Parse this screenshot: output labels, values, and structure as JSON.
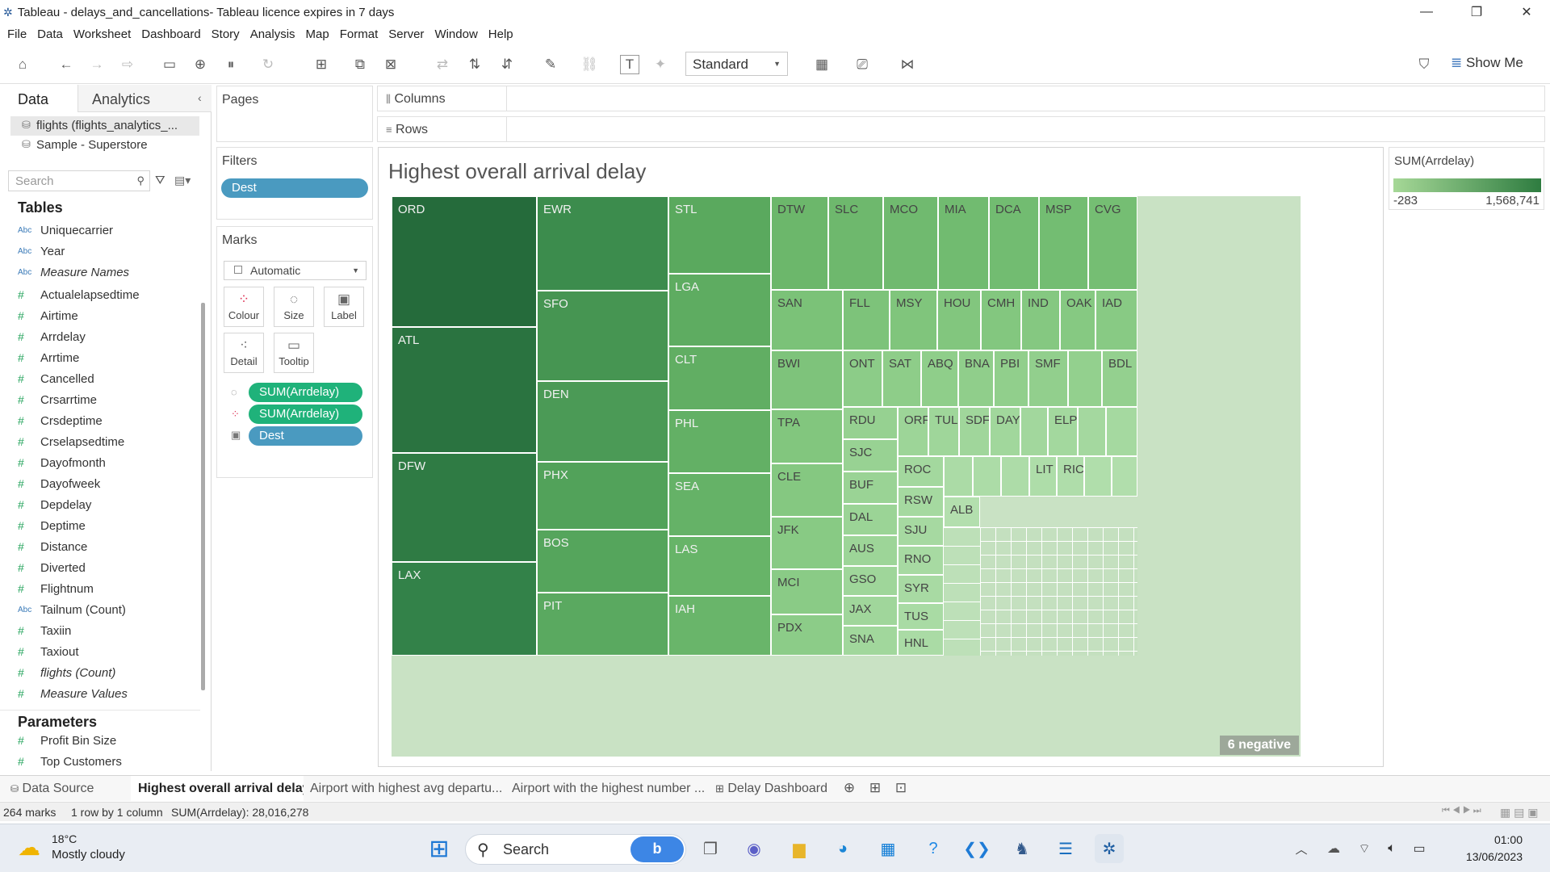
{
  "window": {
    "title": "Tableau - delays_and_cancellations- Tableau licence expires in 7 days"
  },
  "menu": [
    "File",
    "Data",
    "Worksheet",
    "Dashboard",
    "Story",
    "Analysis",
    "Map",
    "Format",
    "Server",
    "Window",
    "Help"
  ],
  "toolbar": {
    "fit_mode": "Standard",
    "show_me": "Show Me"
  },
  "left": {
    "tab_data": "Data",
    "tab_analytics": "Analytics",
    "datasources": [
      "flights (flights_analytics_...",
      "Sample - Superstore"
    ],
    "search_placeholder": "Search",
    "tables_heading": "Tables",
    "fields": [
      {
        "name": "Uniquecarrier",
        "type": "Abc"
      },
      {
        "name": "Year",
        "type": "Abc"
      },
      {
        "name": "Measure Names",
        "type": "Abc"
      },
      {
        "name": "Actualelapsedtime",
        "type": "#"
      },
      {
        "name": "Airtime",
        "type": "#"
      },
      {
        "name": "Arrdelay",
        "type": "#"
      },
      {
        "name": "Arrtime",
        "type": "#"
      },
      {
        "name": "Cancelled",
        "type": "#"
      },
      {
        "name": "Crsarrtime",
        "type": "#"
      },
      {
        "name": "Crsdeptime",
        "type": "#"
      },
      {
        "name": "Crselapsedtime",
        "type": "#"
      },
      {
        "name": "Dayofmonth",
        "type": "#"
      },
      {
        "name": "Dayofweek",
        "type": "#"
      },
      {
        "name": "Depdelay",
        "type": "#"
      },
      {
        "name": "Deptime",
        "type": "#"
      },
      {
        "name": "Distance",
        "type": "#"
      },
      {
        "name": "Diverted",
        "type": "#"
      },
      {
        "name": "Flightnum",
        "type": "#"
      },
      {
        "name": "Tailnum (Count)",
        "type": "Abc"
      },
      {
        "name": "Taxiin",
        "type": "#"
      },
      {
        "name": "Taxiout",
        "type": "#"
      },
      {
        "name": "flights (Count)",
        "type": "#"
      },
      {
        "name": "Measure Values",
        "type": "#"
      }
    ],
    "parameters_heading": "Parameters",
    "parameters": [
      "Profit Bin Size",
      "Top Customers"
    ]
  },
  "pages": {
    "title": "Pages"
  },
  "filters": {
    "title": "Filters",
    "pills": [
      "Dest"
    ]
  },
  "marks": {
    "title": "Marks",
    "type": "Automatic",
    "buttons": [
      "Colour",
      "Size",
      "Label",
      "Detail",
      "Tooltip"
    ],
    "pills": [
      "SUM(Arrdelay)",
      "SUM(Arrdelay)",
      "Dest"
    ]
  },
  "shelves": {
    "columns": "Columns",
    "rows": "Rows"
  },
  "view": {
    "title": "Highest overall arrival delay",
    "negative_badge": "6 negative"
  },
  "legend": {
    "title": "SUM(Arrdelay)",
    "min": "-283",
    "max": "1,568,741"
  },
  "sheet_tabs": [
    "Data Source",
    "Highest overall arrival delay",
    "Airport with highest avg departu...",
    "Airport with the highest number ...",
    "Delay Dashboard"
  ],
  "status": {
    "marks": "264 marks",
    "dims": "1 row by 1 column",
    "sum": "SUM(Arrdelay): 28,016,278"
  },
  "taskbar": {
    "temp": "18°C",
    "weather": "Mostly cloudy",
    "search": "Search",
    "time": "01:00",
    "date": "13/06/2023"
  },
  "colors": {
    "treemap_dark": "#256b3b",
    "treemap_light": "#cfe6ca",
    "pill_blue": "#4a9ac0",
    "pill_green": "#1fb27a"
  },
  "treemap_tiles": [
    {
      "label": "ORD",
      "c": "#256b3b"
    },
    {
      "label": "ATL",
      "c": "#2a7340"
    },
    {
      "label": "DFW",
      "c": "#2f7b44"
    },
    {
      "label": "LAX",
      "c": "#338249"
    },
    {
      "label": "EWR",
      "c": "#3c8c4d"
    },
    {
      "label": "SFO",
      "c": "#469552"
    },
    {
      "label": "DEN",
      "c": "#4b9a56"
    },
    {
      "label": "PHX",
      "c": "#52a25a"
    },
    {
      "label": "BOS",
      "c": "#55a55c"
    },
    {
      "label": "PIT",
      "c": "#5aa960"
    },
    {
      "label": "STL",
      "c": "#5aa95e"
    },
    {
      "label": "LGA",
      "c": "#5eac61"
    },
    {
      "label": "CLT",
      "c": "#61ae63"
    },
    {
      "label": "PHL",
      "c": "#63b065"
    },
    {
      "label": "SEA",
      "c": "#65b267"
    },
    {
      "label": "LAS",
      "c": "#67b468"
    },
    {
      "label": "IAH",
      "c": "#69b56a"
    },
    {
      "label": "DTW",
      "c": "#6cb76b"
    },
    {
      "label": "SLC",
      "c": "#6eb86d"
    },
    {
      "label": "MCO",
      "c": "#70ba6f"
    },
    {
      "label": "MIA",
      "c": "#71bb70"
    },
    {
      "label": "DCA",
      "c": "#72bc71"
    },
    {
      "label": "MSP",
      "c": "#73bd72"
    },
    {
      "label": "CVG",
      "c": "#75be73"
    },
    {
      "label": "SAN",
      "c": "#7bc278"
    },
    {
      "label": "FLL",
      "c": "#7dc37a"
    },
    {
      "label": "MSY",
      "c": "#80c57c"
    },
    {
      "label": "HOU",
      "c": "#82c67e"
    },
    {
      "label": "CMH",
      "c": "#83c77f"
    },
    {
      "label": "IND",
      "c": "#85c881"
    },
    {
      "label": "OAK",
      "c": "#86c982"
    },
    {
      "label": "IAD",
      "c": "#88ca84"
    },
    {
      "label": "BWI",
      "c": "#7ec37b"
    },
    {
      "label": "ONT",
      "c": "#8ccc88"
    },
    {
      "label": "SAT",
      "c": "#8ecd89"
    },
    {
      "label": "ABQ",
      "c": "#8fce8a"
    },
    {
      "label": "BNA",
      "c": "#90ce8b"
    },
    {
      "label": "PBI",
      "c": "#91cf8c"
    },
    {
      "label": "SMF",
      "c": "#92cf8d"
    },
    {
      "label": "",
      "c": "#93d08e"
    },
    {
      "label": "BDL",
      "c": "#94d08f"
    },
    {
      "label": "TPA",
      "c": "#82c67e"
    },
    {
      "label": "CLE",
      "c": "#85c881"
    },
    {
      "label": "JFK",
      "c": "#88ca84"
    },
    {
      "label": "MCI",
      "c": "#8acb86"
    },
    {
      "label": "PDX",
      "c": "#8ccc88"
    },
    {
      "label": "RDU",
      "c": "#96d191"
    },
    {
      "label": "SJC",
      "c": "#98d293"
    },
    {
      "label": "BUF",
      "c": "#9ad395"
    },
    {
      "label": "DAL",
      "c": "#9bd496"
    },
    {
      "label": "AUS",
      "c": "#9dd598"
    },
    {
      "label": "GSO",
      "c": "#9fd69a"
    },
    {
      "label": "JAX",
      "c": "#a0d69b"
    },
    {
      "label": "SNA",
      "c": "#a1d79c"
    },
    {
      "label": "ORF",
      "c": "#9dd598"
    },
    {
      "label": "TUL",
      "c": "#9fd69a"
    },
    {
      "label": "SDF",
      "c": "#a0d69b"
    },
    {
      "label": "DAY",
      "c": "#a1d79c"
    },
    {
      "label": "",
      "c": "#a2d79d"
    },
    {
      "label": "ELP",
      "c": "#a3d89e"
    },
    {
      "label": "",
      "c": "#a4d89f"
    },
    {
      "label": "",
      "c": "#a5d9a0"
    },
    {
      "label": "ROC",
      "c": "#a3d89e"
    },
    {
      "label": "RSW",
      "c": "#a5d9a0"
    },
    {
      "label": "SJU",
      "c": "#a6d9a1"
    },
    {
      "label": "RNO",
      "c": "#a7daa2"
    },
    {
      "label": "SYR",
      "c": "#a8daa3"
    },
    {
      "label": "TUS",
      "c": "#a9dba4"
    },
    {
      "label": "HNL",
      "c": "#aadba5"
    },
    {
      "label": "",
      "c": "#abdba6"
    },
    {
      "label": "",
      "c": "#acdca7"
    },
    {
      "label": "",
      "c": "#addca8"
    },
    {
      "label": "",
      "c": "#aedda9"
    },
    {
      "label": "LIT",
      "c": "#aedda9"
    },
    {
      "label": "RIC",
      "c": "#afddaa"
    },
    {
      "label": "",
      "c": "#b0deab"
    },
    {
      "label": "",
      "c": "#b1deac"
    },
    {
      "label": "ALB",
      "c": "#b3dfae"
    }
  ]
}
